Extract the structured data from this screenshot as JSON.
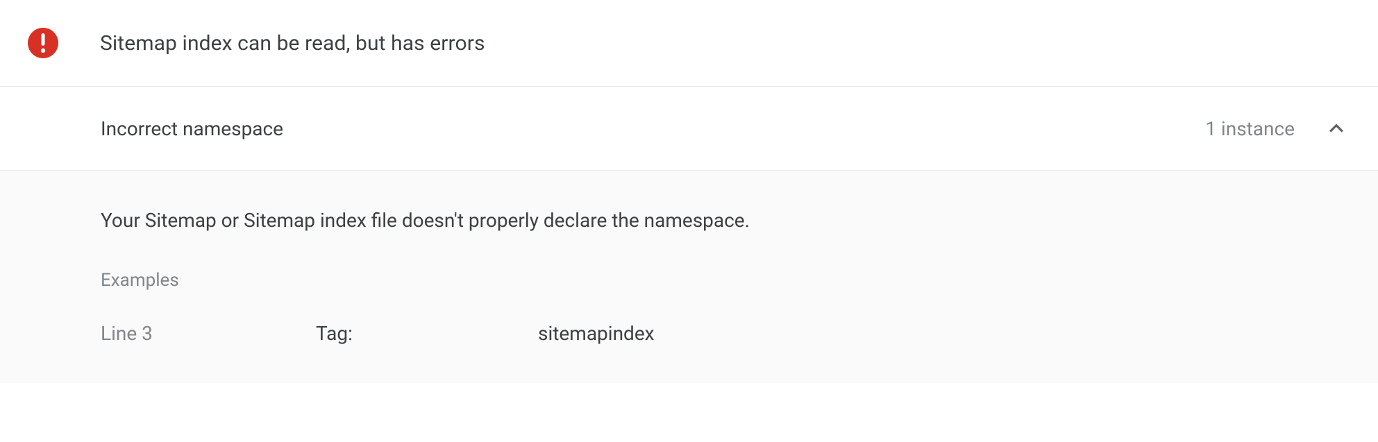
{
  "status": {
    "message": "Sitemap index can be read, but has errors"
  },
  "error": {
    "title": "Incorrect namespace",
    "instance_count": "1 instance",
    "description": "Your Sitemap or Sitemap index file doesn't properly declare the namespace.",
    "examples_label": "Examples",
    "examples": [
      {
        "line_label": "Line 3",
        "tag_label": "Tag:",
        "tag_value": "sitemapindex"
      }
    ]
  }
}
